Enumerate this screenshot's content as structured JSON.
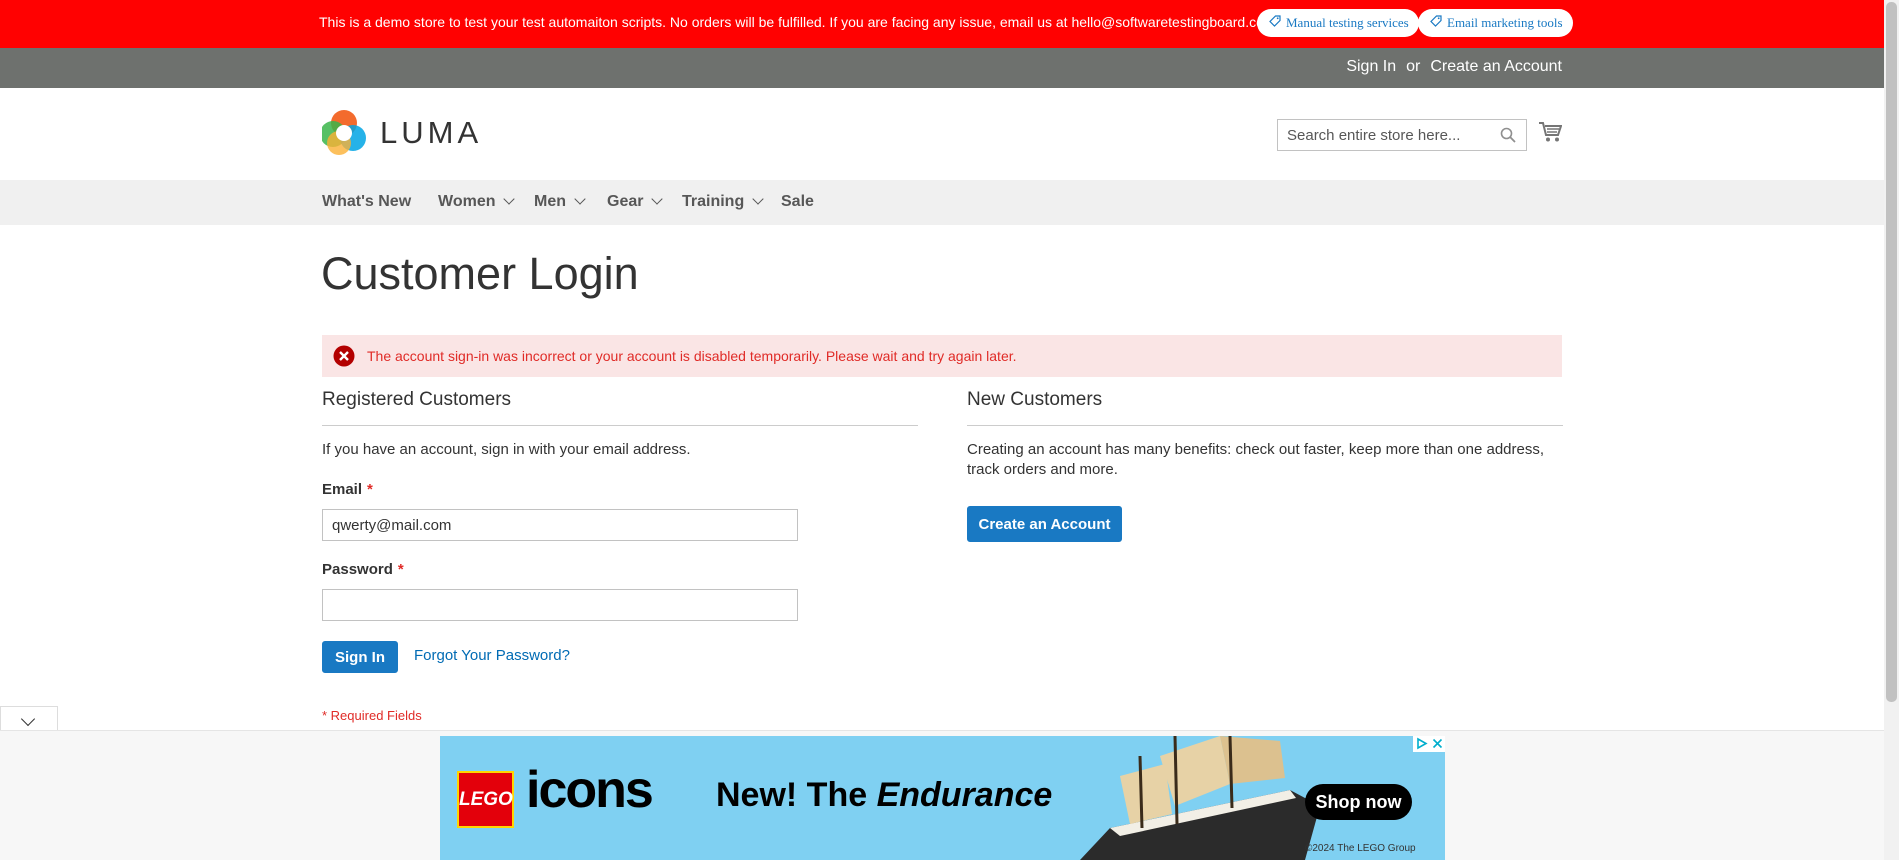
{
  "banner": {
    "message": "This is a demo store to test your test automaiton scripts. No orders will be fulfilled. If you are facing any issue, email us at hello@softwaretestingboard.com.",
    "pills": [
      "Manual testing services",
      "Email marketing tools"
    ]
  },
  "panel": {
    "sign_in": "Sign In",
    "or": "or",
    "create_account": "Create an Account"
  },
  "header": {
    "logo_text": "LUMA",
    "search_placeholder": "Search entire store here...",
    "search_icon": "magnifier-icon",
    "cart_icon": "shopping-cart-icon"
  },
  "nav": {
    "items": [
      {
        "label": "What's New",
        "dropdown": false
      },
      {
        "label": "Women",
        "dropdown": true
      },
      {
        "label": "Men",
        "dropdown": true
      },
      {
        "label": "Gear",
        "dropdown": true
      },
      {
        "label": "Training",
        "dropdown": true
      },
      {
        "label": "Sale",
        "dropdown": false
      }
    ]
  },
  "page": {
    "title": "Customer Login",
    "error_message": "The account sign-in was incorrect or your account is disabled temporarily. Please wait and try again later."
  },
  "registered": {
    "title": "Registered Customers",
    "intro": "If you have an account, sign in with your email address.",
    "email_label": "Email",
    "email_value": "qwerty@mail.com",
    "password_label": "Password",
    "password_value": "",
    "required_mark": "*",
    "sign_in_button": "Sign In",
    "forgot_link": "Forgot Your Password?",
    "required_note": "* Required Fields"
  },
  "new_customers": {
    "title": "New Customers",
    "text": "Creating an account has many benefits: check out faster, keep more than one address, track orders and more.",
    "button": "Create an Account"
  },
  "ad": {
    "brand": "LEGO",
    "sub_brand": "icons",
    "headline_prefix": "New! The ",
    "headline_emphasis": "Endurance",
    "cta": "Shop now",
    "copyright": "©2024 The LEGO Group"
  },
  "colors": {
    "banner_bg": "#ff0101",
    "panel_bg": "#6e716e",
    "nav_bg": "#f0f0f0",
    "primary_button": "#1979c3",
    "link": "#006bb4",
    "error_bg": "#fae5e5",
    "error_text": "#e02b27",
    "ad_bg": "#7fd0f2"
  }
}
